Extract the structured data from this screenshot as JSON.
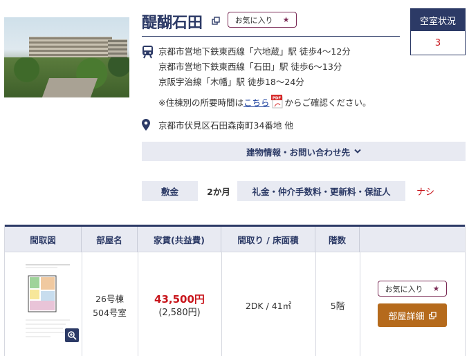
{
  "property": {
    "name": "醍醐石田",
    "favorite_label": "お気に入り",
    "favorite_star": "★"
  },
  "vacancy": {
    "label": "空室状況",
    "count": "3"
  },
  "access": {
    "lines": [
      "京都市営地下鉄東西線「六地蔵」駅 徒歩4～12分",
      "京都市営地下鉄東西線「石田」駅 徒歩6～13分",
      "京阪宇治線「木幡」駅 徒歩18～24分"
    ],
    "note_prefix": "※住棟別の所要時間は",
    "note_link": "こちら",
    "pdf_badge": "PDF",
    "note_suffix": "からご確認ください。"
  },
  "address": "京都市伏見区石田森南町34番地 他",
  "building_info_label": "建物情報・お問い合わせ先",
  "deposit": {
    "label": "敷金",
    "value": "2か月",
    "fees_label": "礼金・仲介手数料・更新料・保証人",
    "fees_value": "ナシ"
  },
  "table": {
    "headers": [
      "間取図",
      "部屋名",
      "家賃(共益費)",
      "間取り / 床面積",
      "階数",
      ""
    ],
    "rows": [
      {
        "room_building": "26号棟",
        "room_number": "504号室",
        "rent": "43,500円",
        "common_fee": "(2,580円)",
        "layout_area": "2DK / 41㎡",
        "floor": "5階",
        "favorite_label": "お気に入り",
        "favorite_star": "★",
        "detail_label": "部屋詳細"
      }
    ]
  },
  "colors": {
    "navy": "#2c3a66",
    "accent_red": "#c8151b",
    "favorite_border": "#7a2a55",
    "detail_button": "#b56a1c",
    "light_bg": "#e8eaf2"
  },
  "icons": [
    "train-icon",
    "location-pin-icon",
    "external-link-icon",
    "pdf-icon",
    "chevron-down-icon",
    "zoom-icon"
  ]
}
